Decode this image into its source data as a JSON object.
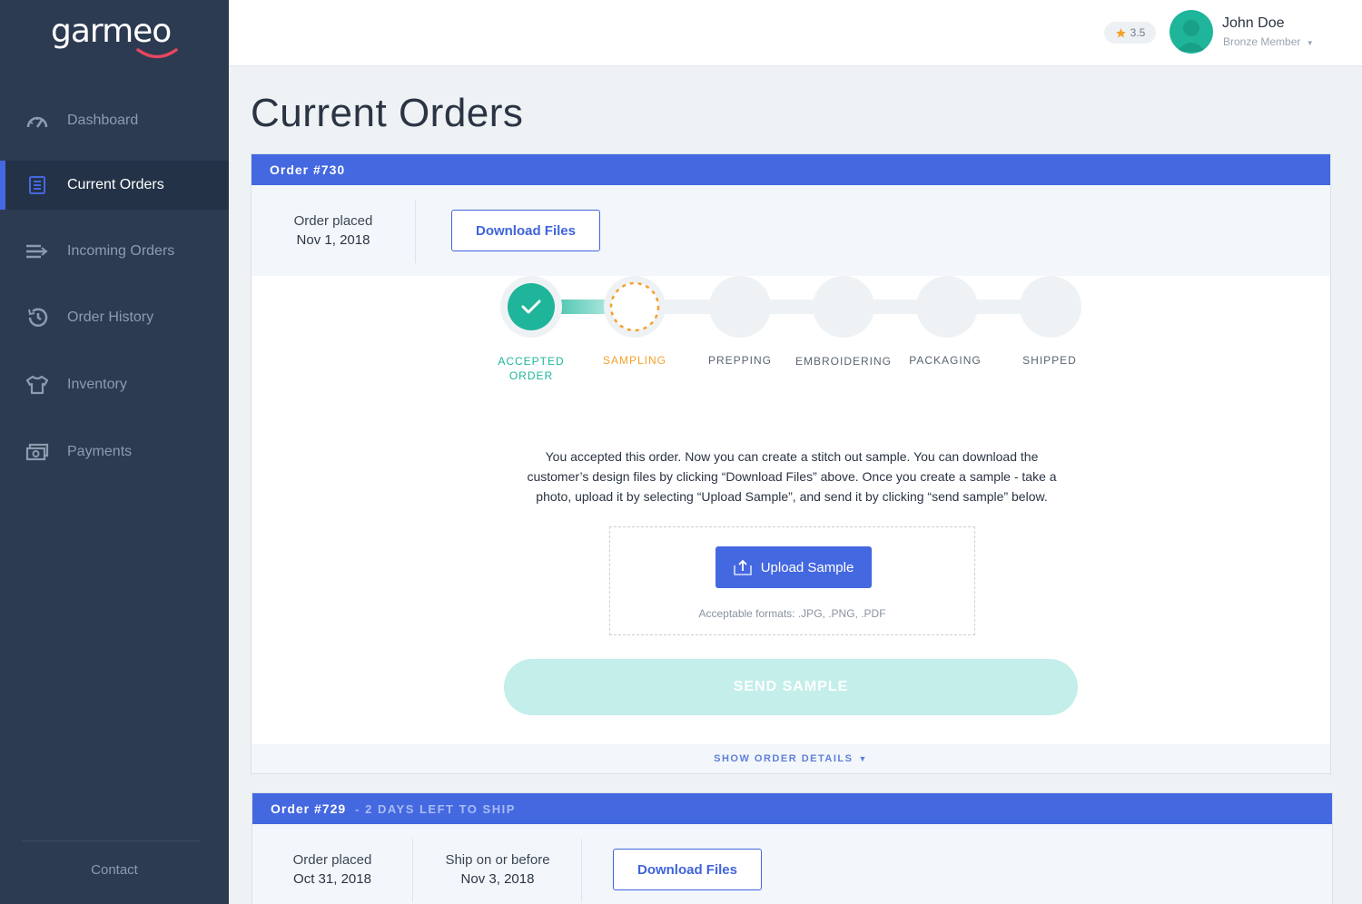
{
  "brand": {
    "name": "garmeo"
  },
  "sidebar": {
    "items": [
      {
        "label": "Dashboard",
        "icon": "speedometer-icon"
      },
      {
        "label": "Current Orders",
        "icon": "list-icon",
        "active": true
      },
      {
        "label": "Incoming Orders",
        "icon": "incoming-arrow-icon"
      },
      {
        "label": "Order History",
        "icon": "history-icon"
      },
      {
        "label": "Inventory",
        "icon": "tshirt-icon"
      },
      {
        "label": "Payments",
        "icon": "money-icon"
      }
    ],
    "contact": "Contact"
  },
  "header": {
    "rating": "3.5",
    "user": {
      "name": "John Doe",
      "role": "Bronze Member"
    }
  },
  "page": {
    "title": "Current Orders"
  },
  "orders": [
    {
      "title": "Order #730",
      "placed_label": "Order placed",
      "placed_date": "Nov 1, 2018",
      "download_label": "Download Files",
      "steps": [
        {
          "label": "ACCEPTED",
          "label2": "ORDER",
          "state": "done"
        },
        {
          "label": "SAMPLING",
          "state": "current"
        },
        {
          "label": "PREPPING",
          "state": "pending"
        },
        {
          "label": "EMBROIDERING",
          "state": "pending"
        },
        {
          "label": "PACKAGING",
          "state": "pending"
        },
        {
          "label": "SHIPPED",
          "state": "pending"
        }
      ],
      "description": "You accepted this order. Now you can create a stitch out sample. You can download the customer’s design files by clicking “Download Files” above. Once you create a sample - take a photo, upload it by selecting “Upload Sample”, and send it by clicking “send sample” below.",
      "upload_label": "Upload Sample",
      "formats": "Acceptable formats: .JPG, .PNG, .PDF",
      "send_label": "SEND SAMPLE",
      "details_label": "SHOW ORDER DETAILS"
    },
    {
      "title": "Order #729",
      "warning": "- 2 DAYS LEFT TO SHIP",
      "placed_label": "Order placed",
      "placed_date": "Oct 31, 2018",
      "ship_label": "Ship on or before",
      "ship_date": "Nov 3, 2018",
      "download_label": "Download Files"
    }
  ],
  "colors": {
    "sidebar": "#2c3b52",
    "accent": "#4468e0",
    "success": "#1fb59b",
    "warning": "#f4a12c",
    "send_disabled": "#c3eeea"
  }
}
